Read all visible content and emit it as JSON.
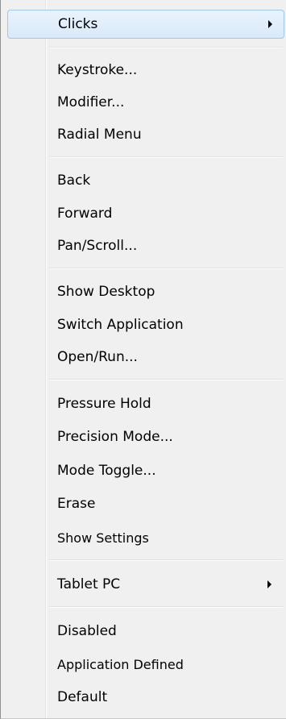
{
  "menu": {
    "items": [
      {
        "label": "Clicks"
      },
      {
        "label": "Keystroke..."
      },
      {
        "label": "Modifier..."
      },
      {
        "label": "Radial Menu"
      },
      {
        "label": "Back"
      },
      {
        "label": "Forward"
      },
      {
        "label": "Pan/Scroll..."
      },
      {
        "label": "Show Desktop"
      },
      {
        "label": "Switch Application"
      },
      {
        "label": "Open/Run..."
      },
      {
        "label": "Pressure Hold"
      },
      {
        "label": "Precision Mode..."
      },
      {
        "label": "Mode Toggle..."
      },
      {
        "label": "Erase"
      },
      {
        "label": "Show Settings"
      },
      {
        "label": "Tablet PC"
      },
      {
        "label": "Disabled"
      },
      {
        "label": "Application Defined"
      },
      {
        "label": "Default"
      }
    ],
    "hover_color": "#d9e9fa",
    "border_color": "#9ec7ee",
    "submenu_icon": "submenu-arrow-icon"
  }
}
